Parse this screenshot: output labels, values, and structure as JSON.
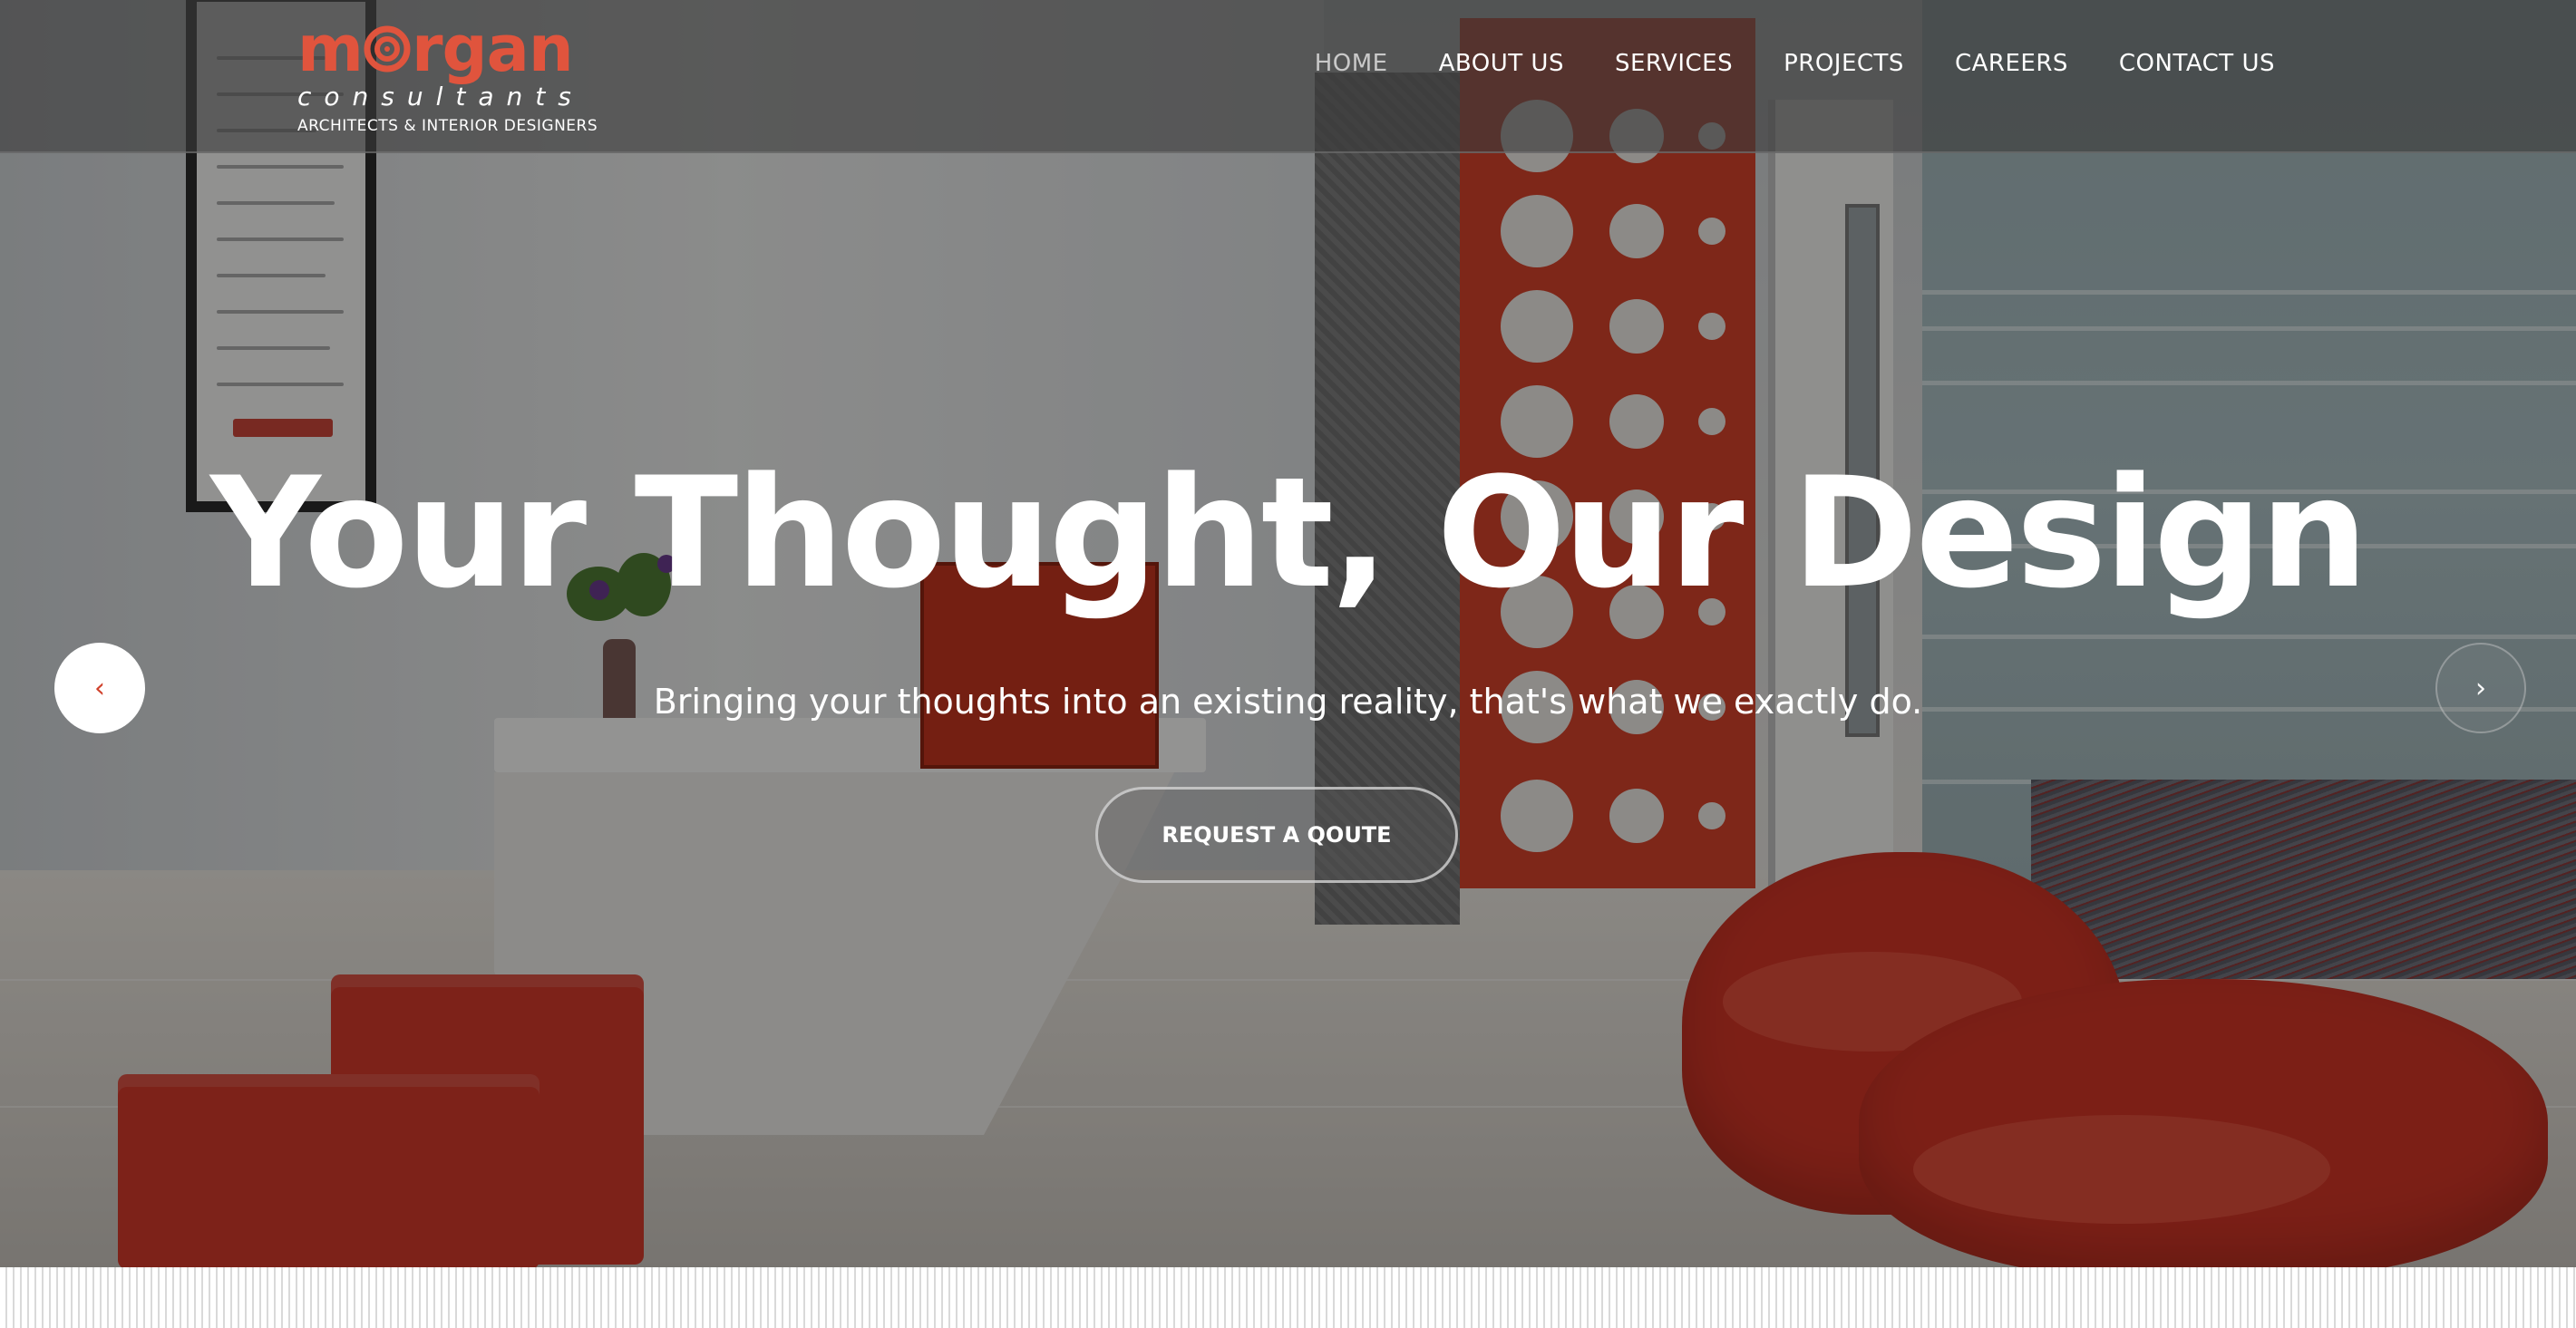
{
  "brand": {
    "name_before": "m",
    "name_after": "rgan",
    "sub": "consultants",
    "tagline": "ARCHITECTS & INTERIOR DESIGNERS",
    "accent_color": "#e0543d"
  },
  "nav": {
    "items": [
      {
        "label": "HOME",
        "active": true
      },
      {
        "label": "ABOUT US",
        "active": false
      },
      {
        "label": "SERVICES",
        "active": false
      },
      {
        "label": "PROJECTS",
        "active": false
      },
      {
        "label": "CAREERS",
        "active": false
      },
      {
        "label": "CONTACT US",
        "active": false
      }
    ]
  },
  "hero": {
    "headline": "Your Thought, Our Design",
    "subheadline": "Bringing your thoughts into an existing reality, that's what we exactly do.",
    "cta_label": "REQUEST A QOUTE",
    "prev_icon": "‹",
    "next_icon": "›"
  }
}
